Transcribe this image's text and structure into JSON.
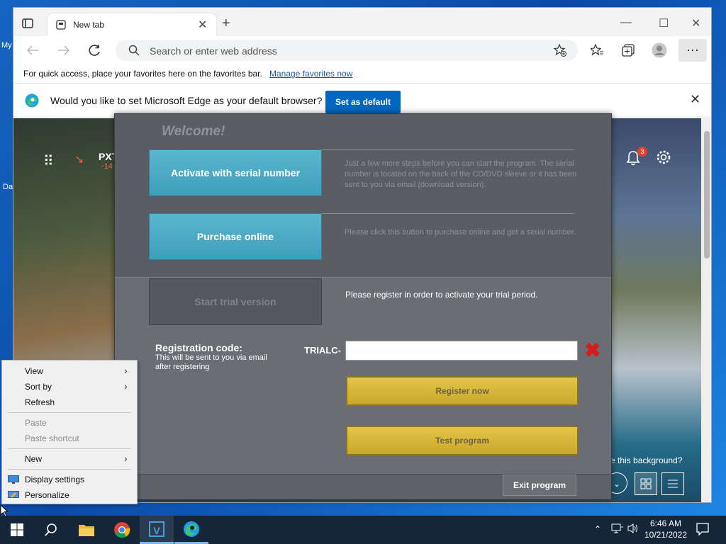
{
  "desktop": {
    "icon_text_1": "My",
    "icon_text_2": "Da"
  },
  "browser": {
    "tab_title": "New tab",
    "new_tab_symbol": "+",
    "tab_close_symbol": "✕",
    "window_controls": {
      "minimize": "—",
      "maximize": "☐",
      "close": "✕"
    },
    "address_placeholder": "Search or enter web address",
    "favorites_bar": {
      "text": "For quick access, place your favorites here on the favorites bar.",
      "link": "Manage favorites now"
    },
    "infobar": {
      "question": "Would you like to set Microsoft Edge as your default browser?",
      "button": "Set as default"
    },
    "newtab_page": {
      "stock_ticker": "PXT",
      "stock_change": "-14",
      "notification_count": "3",
      "background_question": "e this background?"
    }
  },
  "dialog": {
    "title": "Welcome!",
    "activate_button": "Activate with serial number",
    "activate_desc": "Just a few more steps before you can start the program. The serial number is located on the back of the CD/DVD sleeve or it has been sent to you via email (download version).",
    "purchase_button": "Purchase online",
    "purchase_desc": "Please click this button to purchase online and get a serial number.",
    "trial_button": "Start trial version",
    "trial_desc": "Please register in order to activate your trial period.",
    "reg_label": "Registration code:",
    "reg_sublabel": "This will be sent to you via email after registering",
    "reg_prefix": "TRIALC-",
    "reg_value": "",
    "clear_symbol": "✖",
    "register_button": "Register now",
    "test_button": "Test program",
    "exit_button": "Exit program"
  },
  "context_menu": {
    "items": [
      {
        "label": "View",
        "arrow": "›"
      },
      {
        "label": "Sort by",
        "arrow": "›"
      },
      {
        "label": "Refresh"
      },
      {
        "label": "Paste"
      },
      {
        "label": "Paste shortcut"
      },
      {
        "label": "New",
        "arrow": "›"
      },
      {
        "label": "Display settings"
      },
      {
        "label": "Personalize"
      }
    ]
  },
  "taskbar": {
    "time": "6:46 AM",
    "date": "10/21/2022",
    "edge_active_label": "V"
  },
  "colors": {
    "accent_blue": "#0067c0",
    "dialog_blue_button": "#4aa9c4",
    "gold_button": "#d6b43a",
    "red_x": "#d81c1c"
  }
}
